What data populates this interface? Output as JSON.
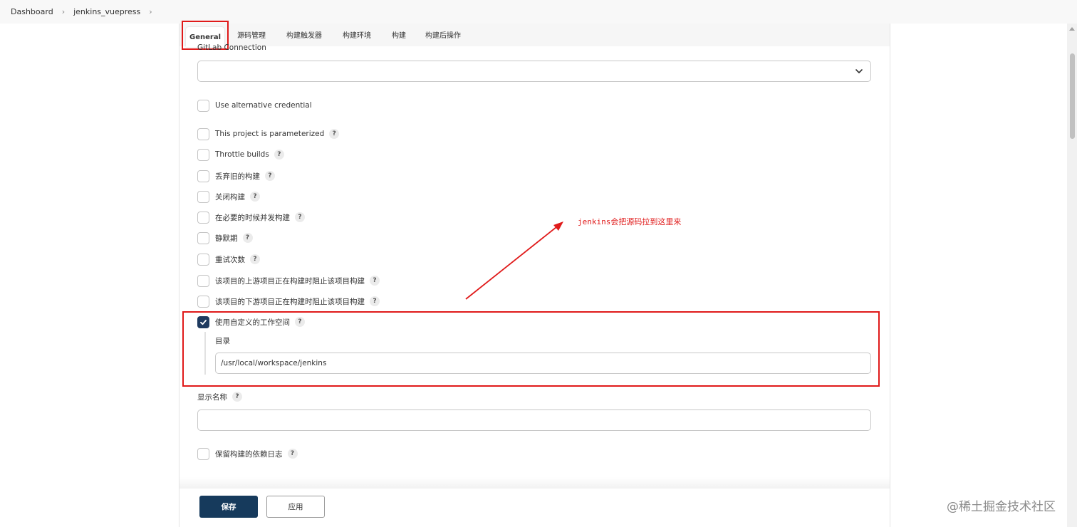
{
  "breadcrumb": {
    "items": [
      "Dashboard",
      "jenkins_vuepress"
    ],
    "separator": "›"
  },
  "tabs": [
    {
      "label": "General",
      "active": true
    },
    {
      "label": "源码管理"
    },
    {
      "label": "构建触发器"
    },
    {
      "label": "构建环境"
    },
    {
      "label": "构建"
    },
    {
      "label": "构建后操作"
    }
  ],
  "gitlab": {
    "label": "GitLab Connection",
    "value": ""
  },
  "options": [
    {
      "label": "Use alternative credential",
      "checked": false,
      "help": false
    },
    {
      "label": "This project is parameterized",
      "checked": false,
      "help": true
    },
    {
      "label": "Throttle builds",
      "checked": false,
      "help": true
    },
    {
      "label": "丢弃旧的构建",
      "checked": false,
      "help": true
    },
    {
      "label": "关闭构建",
      "checked": false,
      "help": true
    },
    {
      "label": "在必要的时候并发构建",
      "checked": false,
      "help": true
    },
    {
      "label": "静默期",
      "checked": false,
      "help": true
    },
    {
      "label": "重试次数",
      "checked": false,
      "help": true
    },
    {
      "label": "该项目的上游项目正在构建时阻止该项目构建",
      "checked": false,
      "help": true
    },
    {
      "label": "该项目的下游项目正在构建时阻止该项目构建",
      "checked": false,
      "help": true
    },
    {
      "label": "使用自定义的工作空间",
      "checked": true,
      "help": true
    }
  ],
  "workspace": {
    "directory_label": "目录",
    "directory_value": "/usr/local/workspace/jenkins"
  },
  "display_name": {
    "label": "显示名称",
    "value": ""
  },
  "keep_dependency_log": {
    "label": "保留构建的依赖日志",
    "checked": false
  },
  "help_symbol": "?",
  "annotation": "jenkins会把源码拉到这里来",
  "buttons": {
    "save": "保存",
    "apply": "应用"
  },
  "watermark": "@稀土掘金技术社区",
  "colors": {
    "primary": "#163a5c",
    "highlight": "#e01a1a",
    "checked": "#1e3a5f"
  }
}
